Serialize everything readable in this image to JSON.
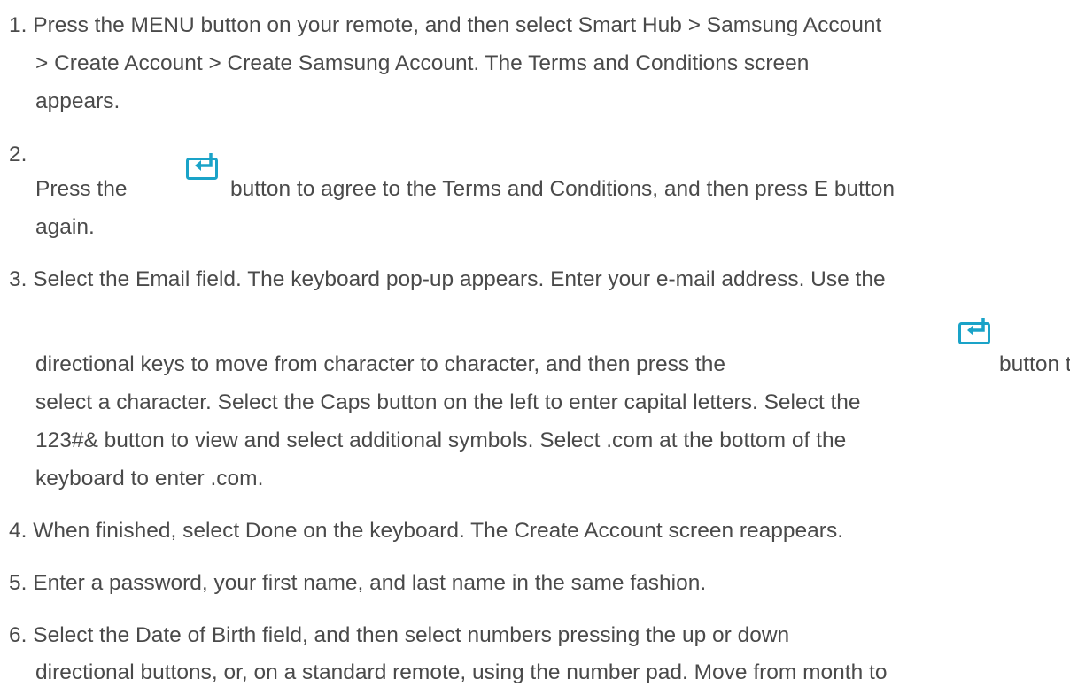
{
  "steps": [
    {
      "number": "1.",
      "lines": [
        "Press the MENU button on your remote, and then select Smart Hub > Samsung Account",
        "> Create Account > Create Samsung Account. The Terms and Conditions screen",
        "appears."
      ]
    },
    {
      "number": "2.",
      "line1_before_icon": "Press the",
      "line1_after_icon": "button to agree to the Terms and Conditions, and then press E button",
      "line2": "again.",
      "icon": "enter-key-icon"
    },
    {
      "number": "3.",
      "line1": "Select the Email field. The keyboard pop-up appears. Enter your e-mail address. Use the",
      "line2_before_icon": "directional keys to move from character to character, and then press the",
      "line2_after_icon": "button to",
      "line3": "select a character. Select the Caps button on the left to enter capital letters. Select the",
      "line4": "123#& button to view and select additional symbols. Select .com at the bottom of the",
      "line5": "keyboard to enter .com.",
      "icon": "enter-key-icon"
    },
    {
      "number": "4.",
      "line1": "When finished, select Done on the keyboard. The Create Account screen reappears."
    },
    {
      "number": "5.",
      "line1": "Enter a password, your first name, and last name in the same fashion."
    },
    {
      "number": "6.",
      "lines": [
        "Select the Date of Birth field, and then select numbers pressing the up or down",
        "directional buttons, or, on a standard remote, using the number pad. Move from month to"
      ]
    }
  ],
  "colors": {
    "text": "#4a4a4a",
    "icon_accent": "#1aa3c8"
  }
}
